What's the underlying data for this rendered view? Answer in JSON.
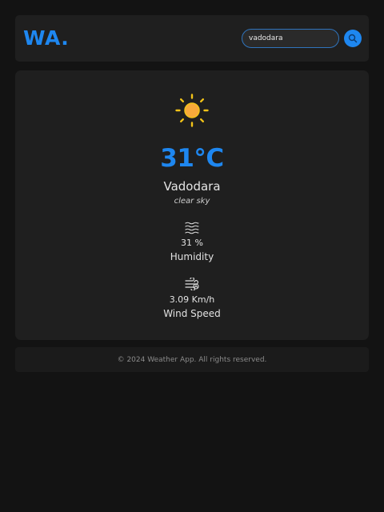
{
  "app": {
    "logo": "WA."
  },
  "search": {
    "value": "vadodara",
    "button_icon": "search-icon"
  },
  "weather": {
    "icon": "sun-icon",
    "temperature": "31°C",
    "city": "Vadodara",
    "description": "clear sky",
    "humidity": {
      "icon": "humidity-waves-icon",
      "value": "31 %",
      "label": "Humidity"
    },
    "wind": {
      "icon": "wind-icon",
      "value": "3.09 Km/h",
      "label": "Wind Speed"
    }
  },
  "footer": {
    "text": "© 2024 Weather App. All rights reserved."
  },
  "colors": {
    "accent": "#1e87f0",
    "background": "#131313",
    "panel": "#1f1f1f",
    "sun": "#f7a93b",
    "sun_rays": "#f2c318"
  }
}
